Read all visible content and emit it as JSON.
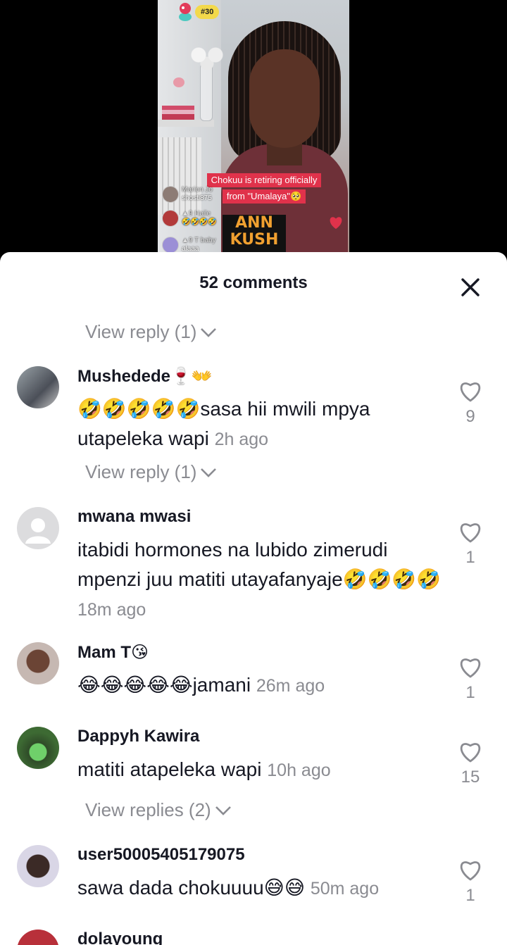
{
  "video": {
    "rank_badge": "#30",
    "caption_lines": [
      "Chokuu is retiring officially",
      "from \"Umalaya\"🥺"
    ],
    "live_comments": [
      {
        "name": "Marion Jo",
        "text": "shosti875"
      },
      {
        "name": "▲9 Haile",
        "text": "🤣🤣🤣🤣"
      },
      {
        "name": "▲9 T baby",
        "text": "alaaa"
      }
    ],
    "logo_text": "ANN KUSH"
  },
  "sheet": {
    "title": "52 comments",
    "view_reply_top": "View reply (1)",
    "comments": [
      {
        "username": "Mushedede🍷👐",
        "text": "🤣🤣🤣🤣🤣sasa hii mwili mpya utapeleka wapi",
        "time": "2h ago",
        "likes": "9",
        "view_replies": "View reply (1)"
      },
      {
        "username": "mwana mwasi",
        "text": "itabidi hormones na lubido zimerudi mpenzi juu matiti utayafanyaje🤣🤣🤣🤣",
        "time": "18m ago",
        "likes": "1",
        "view_replies": ""
      },
      {
        "username": "Mam T😘",
        "text": "😂😂😂😂😂jamani",
        "time": "26m ago",
        "likes": "1",
        "view_replies": ""
      },
      {
        "username": "Dappyh Kawira",
        "text": "matiti atapeleka wapi",
        "time": "10h ago",
        "likes": "15",
        "view_replies": "View replies (2)"
      },
      {
        "username": "user50005405179075",
        "text": "sawa dada chokuuuu😅😅",
        "time": "50m ago",
        "likes": "1",
        "view_replies": ""
      },
      {
        "username": "dolayoung",
        "text": "",
        "time": "",
        "likes": "",
        "view_replies": ""
      }
    ]
  },
  "colors": {
    "accent_red": "#e0324b",
    "text_primary": "#161823",
    "text_secondary": "#8a8b91"
  }
}
